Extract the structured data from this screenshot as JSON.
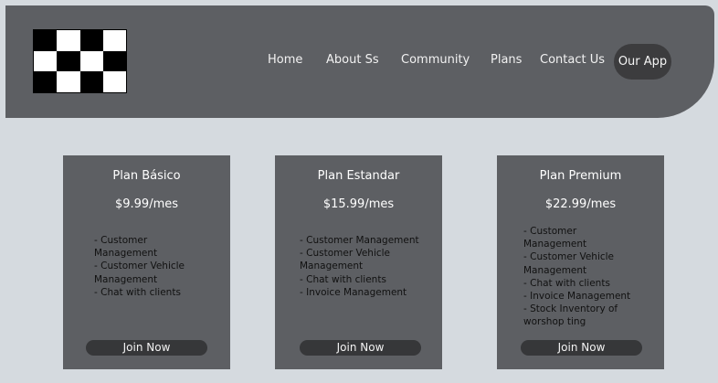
{
  "nav": {
    "items": [
      "Home",
      "About Ss",
      "Community",
      "Plans",
      "Contact Us"
    ],
    "app_button": "Our App"
  },
  "plans": [
    {
      "name": "Plan Básico",
      "price": "$9.99/mes",
      "features": [
        "- Customer Management",
        "- Customer Vehicle Management",
        "- Chat with clients"
      ],
      "button": "Join Now"
    },
    {
      "name": "Plan Estandar",
      "price": "$15.99/mes",
      "features": [
        "- Customer Management",
        "- Customer Vehicle Management",
        "- Chat with clients",
        "- Invoice Management"
      ],
      "button": "Join Now"
    },
    {
      "name": "Plan Premium",
      "price": "$22.99/mes",
      "features": [
        "- Customer Management",
        "- Customer Vehicle Management",
        "- Chat with clients",
        "- Invoice Management",
        "- Stock Inventory of worshop ting"
      ],
      "button": "Join Now"
    }
  ],
  "colors": {
    "page_background": "#d5dadf",
    "header_background": "#5d5f63",
    "card_background": "#5d5f63",
    "button_background": "#363739"
  }
}
